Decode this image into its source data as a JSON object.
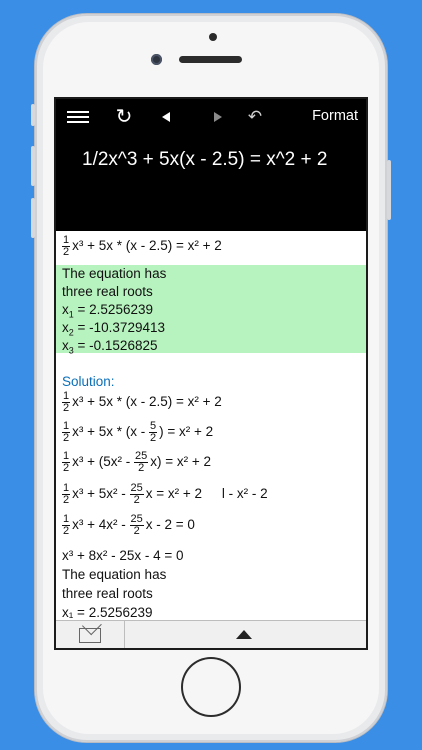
{
  "toolbar": {
    "format_label": "Format",
    "icons": [
      "menu-icon",
      "refresh-icon",
      "back-icon",
      "forward-icon",
      "undo-icon"
    ]
  },
  "input_expression": "1/2x^3 + 5x(x - 2.5) = x^2 + 2",
  "result": {
    "heading1": "The equation has",
    "heading2": "three real roots",
    "roots": [
      {
        "name": "x",
        "sub": "1",
        "value": "= 2.5256239"
      },
      {
        "name": "x",
        "sub": "2",
        "value": "= -10.3729413"
      },
      {
        "name": "x",
        "sub": "3",
        "value": "= -0.1526825"
      }
    ]
  },
  "solution_title": "Solution:",
  "steps": {
    "original_tail": "x³ + 5x * (x - 2.5) = x² + 2",
    "s1_tail": "x³ + 5x * (x - 2.5) = x² + 2",
    "s2_mid": "x³ + 5x * (x -",
    "s2_tail": ") = x² + 2",
    "s3_mid": "x³ + (5x² -",
    "s3_tail": "x) = x² + 2",
    "s4_mid": "x³ + 5x² -",
    "s4_tail": "x = x² + 2",
    "s4_op": "l - x² - 2",
    "s5_mid": "x³ + 4x² -",
    "s5_tail": "x - 2 = 0",
    "s6": "x³ + 8x² - 25x - 4 = 0",
    "s7": "The equation has",
    "s8": "three real roots",
    "s9": "x₁ = 2.5256239"
  },
  "fractions": {
    "half_num": "1",
    "half_den": "2",
    "five_halves_num": "5",
    "twentyfive_halves_num": "25"
  },
  "colors": {
    "background": "#3a8ee6",
    "result_highlight": "#b7f3be",
    "solution_label": "#0b6fb7"
  }
}
